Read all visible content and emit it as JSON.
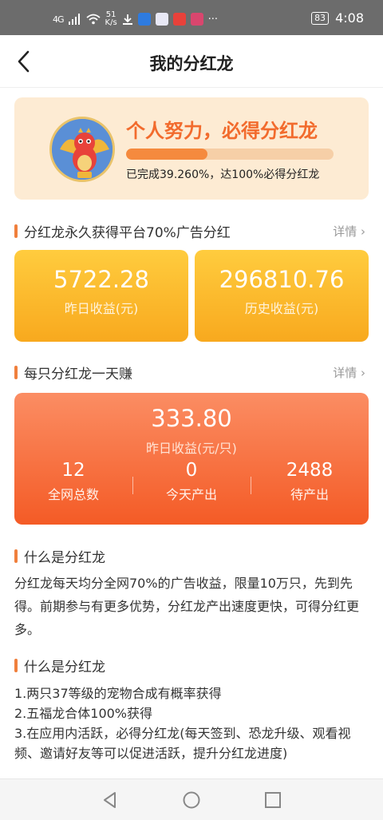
{
  "status_bar": {
    "network": "4G",
    "speed_value": "51",
    "speed_unit": "K/s",
    "more": "···",
    "battery": "83",
    "time": "4:08"
  },
  "nav": {
    "title": "我的分红龙"
  },
  "hero": {
    "title": "个人努力，必得分红龙",
    "progress_percent": 39.26,
    "progress_text": "已完成39.260%，达100%必得分红龙"
  },
  "section_earnings": {
    "title": "分红龙永久获得平台70%广告分红",
    "link": "详情 ›",
    "yesterday_value": "5722.28",
    "yesterday_label": "昨日收益(元)",
    "history_value": "296810.76",
    "history_label": "历史收益(元)"
  },
  "section_daily": {
    "title": "每只分红龙一天赚",
    "link": "详情 ›",
    "value": "333.80",
    "label": "昨日收益(元/只)",
    "stats": [
      {
        "value": "12",
        "label": "全网总数"
      },
      {
        "value": "0",
        "label": "今天产出"
      },
      {
        "value": "2488",
        "label": "待产出"
      }
    ]
  },
  "section_what1": {
    "title": "什么是分红龙",
    "body": "分红龙每天均分全网70%的广告收益，限量10万只，先到先得。前期参与有更多优势，分红龙产出速度更快，可得分红更多。"
  },
  "section_what2": {
    "title": "什么是分红龙",
    "items": [
      "1.两只37等级的宠物合成有概率获得",
      "2.五福龙合体100%获得",
      "3.在应用内活跃，必得分红龙(每天签到、恐龙升级、观看视频、邀请好友等可以促进活跃，提升分红龙进度)"
    ]
  },
  "colors": {
    "accent_orange": "#f26b2d",
    "yellow_card": "#ffcc3e",
    "red_card": "#f45b26"
  }
}
